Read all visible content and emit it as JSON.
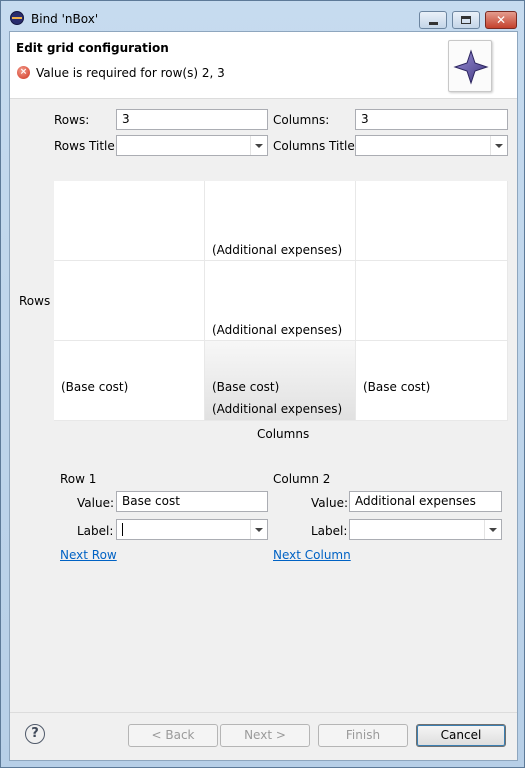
{
  "window": {
    "title": "Bind 'nBox'",
    "close_glyph": "✕"
  },
  "header": {
    "title": "Edit grid configuration",
    "error_message": "Value is required for row(s) 2, 3",
    "error_icon": "error-icon",
    "banner_icon": "star-icon"
  },
  "config": {
    "rows_label": "Rows:",
    "rows_value": "3",
    "columns_label": "Columns:",
    "columns_value": "3",
    "rows_title_label": "Rows Title:",
    "rows_title_value": "",
    "columns_title_label": "Columns Title:",
    "columns_title_value": ""
  },
  "grid": {
    "rows_axis_label": "Rows",
    "columns_axis_label": "Columns",
    "cells": [
      [
        "",
        "(Additional expenses)",
        ""
      ],
      [
        "",
        "(Additional expenses)",
        ""
      ],
      [
        "(Base cost)",
        "(Base cost)|(Additional expenses)",
        "(Base cost)"
      ]
    ],
    "c00": "",
    "c01": "(Additional expenses)",
    "c02": "",
    "c10": "",
    "c11": "(Additional expenses)",
    "c12": "",
    "c20": "(Base cost)",
    "c21a": "(Base cost)",
    "c21b": "(Additional expenses)",
    "c22": "(Base cost)"
  },
  "row_editor": {
    "heading": "Row 1",
    "value_label": "Value:",
    "value": "Base cost",
    "label_label": "Label:",
    "label_value": "",
    "next_link": "Next Row"
  },
  "column_editor": {
    "heading": "Column 2",
    "value_label": "Value:",
    "value": "Additional expenses",
    "label_label": "Label:",
    "label_value": "",
    "next_link": "Next Column"
  },
  "buttons": {
    "help": "?",
    "back": "< Back",
    "next": "Next >",
    "finish": "Finish",
    "cancel": "Cancel"
  }
}
